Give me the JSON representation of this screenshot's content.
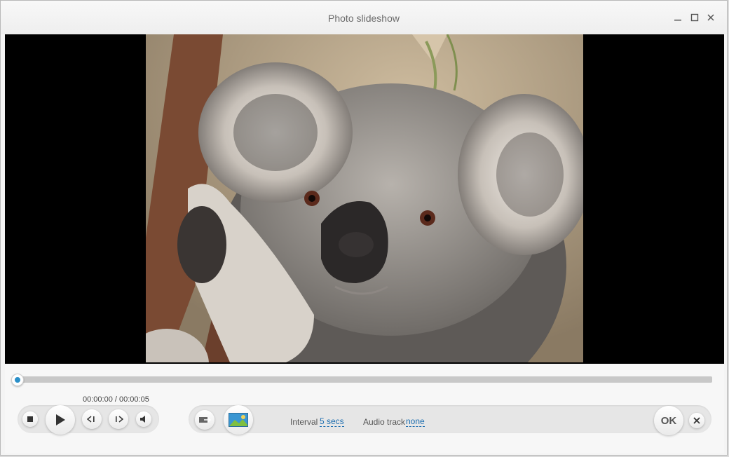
{
  "window": {
    "title": "Photo slideshow",
    "minimize_icon": "minimize-icon",
    "maximize_icon": "maximize-icon",
    "close_icon": "close-icon"
  },
  "player": {
    "time_display": "00:00:00 / 00:00:05",
    "seek_progress": 0,
    "icons": [
      "stop-icon",
      "play-icon",
      "previous-icon",
      "next-icon",
      "volume-icon",
      "add-photos-icon",
      "thumbnail-icon"
    ]
  },
  "settings": {
    "interval_label": "Interval",
    "interval_value": "5 secs",
    "audio_label": "Audio track",
    "audio_value": "none"
  },
  "actions": {
    "ok_label": "OK",
    "cancel_icon": "cancel-icon"
  },
  "colors": {
    "accent": "#2a8fc8",
    "link": "#1f6fb0"
  }
}
